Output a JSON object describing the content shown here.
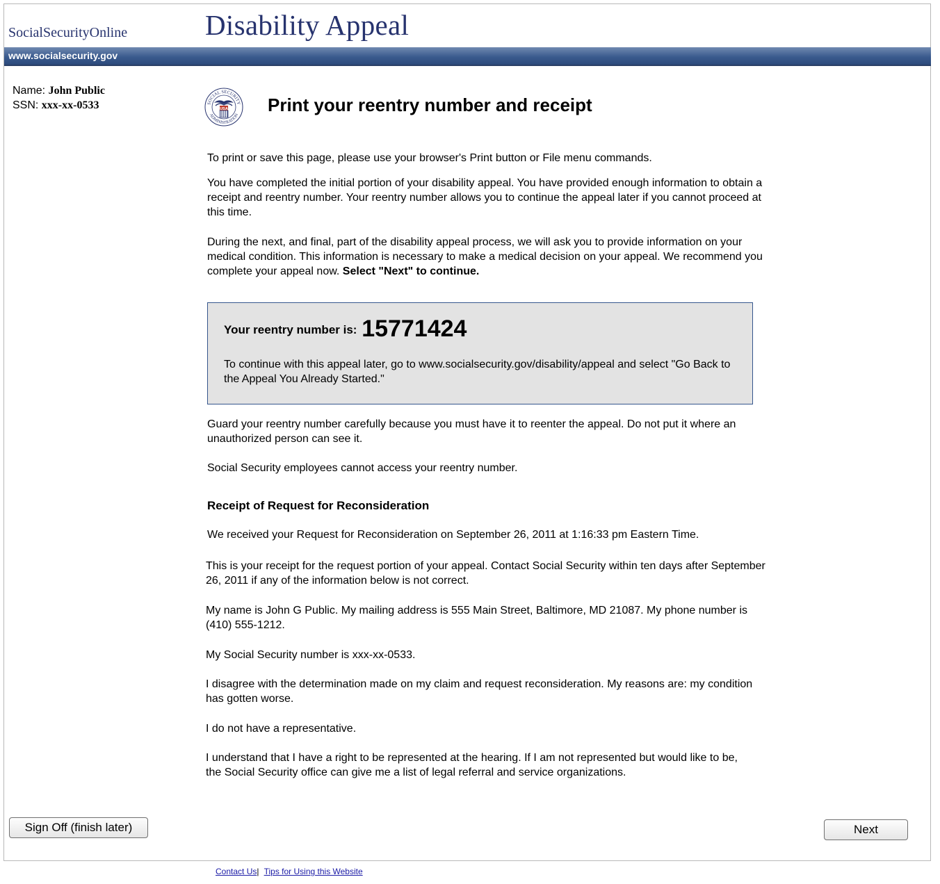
{
  "header": {
    "brand": "SocialSecurityOnline",
    "title": "Disability Appeal",
    "url": "www.socialsecurity.gov"
  },
  "user": {
    "name_label": "Name:",
    "name_value": "John Public",
    "ssn_label": "SSN:",
    "ssn_value": "xxx-xx-0533"
  },
  "seal": {
    "icon": "ssa-seal-icon",
    "top_text": "SOCIAL SECURITY",
    "badge": "USA",
    "bottom_text": "ADMINISTRATION"
  },
  "page": {
    "heading": "Print your reentry number and receipt",
    "print_instruction": "To print or save this page, please use your browser's Print button or File menu commands.",
    "completed_text": "You have completed the initial portion of your disability appeal. You have provided enough information to obtain a receipt and reentry number. Your reentry number allows you to continue the appeal later if you cannot proceed at this time.",
    "next_part_text": "During the next, and final, part of the disability appeal process, we will ask you to provide information on your medical condition. This information is necessary to make a medical decision on your appeal. We recommend you complete your appeal now.",
    "next_part_emphasis": "Select \"Next\" to continue.",
    "reentry": {
      "label": "Your reentry number is:",
      "number": "15771424",
      "note": "To continue with this appeal later, go to www.socialsecurity.gov/disability/appeal and select \"Go Back to the Appeal You Already Started.\""
    },
    "guard_text": "Guard your reentry number carefully because you must have it to reenter the appeal. Do not put it where an unauthorized person can see it.",
    "employees_text": "Social Security employees cannot access your reentry number."
  },
  "receipt": {
    "heading": "Receipt of Request for Reconsideration",
    "received": "We received your Request for Reconsideration on September 26, 2011 at 1:16:33 pm Eastern Time.",
    "receipt_note": "This is your receipt for the request portion of your appeal. Contact Social Security within ten days after September 26, 2011 if any of the information below is not correct.",
    "name_address": "My name is John G Public. My mailing address is 555 Main Street, Baltimore, MD 21087. My phone number is (410) 555-1212.",
    "ssn": "My Social Security number is xxx-xx-0533.",
    "disagree": "I disagree with the determination made on my claim and request reconsideration. My reasons are: my condition has gotten worse.",
    "representative": "I do not have a representative.",
    "right": "I understand that I have a right to be represented at the hearing. If I am not represented but would like to be, the Social Security office can give me a list of legal referral and service organizations."
  },
  "buttons": {
    "sign_off": "Sign Off (finish later)",
    "next": "Next"
  },
  "footer": {
    "contact": "Contact Us",
    "separator": "|",
    "tips": "Tips for Using this Website"
  }
}
